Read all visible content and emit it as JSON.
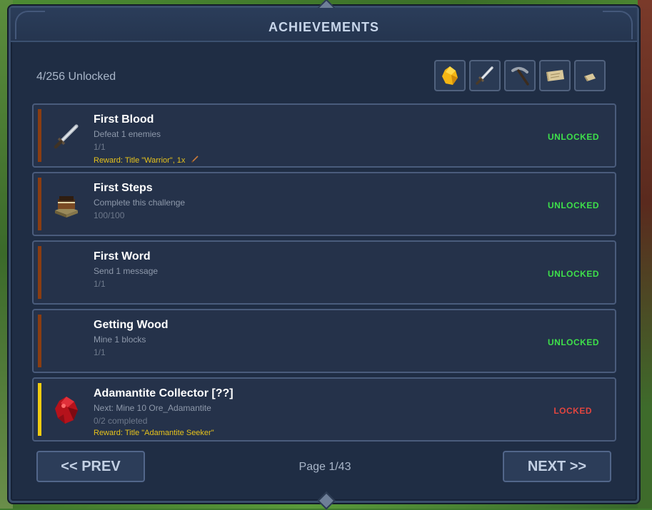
{
  "window": {
    "title": "ACHIEVEMENTS"
  },
  "summary": {
    "unlocked_text": "4/256 Unlocked"
  },
  "filters": [
    {
      "icon": "gold-ore-icon"
    },
    {
      "icon": "sword-icon"
    },
    {
      "icon": "pickaxe-icon"
    },
    {
      "icon": "map-scroll-icon"
    },
    {
      "icon": "letter-icon"
    }
  ],
  "achievements": [
    {
      "name": "First Blood",
      "description": "Defeat 1 enemies",
      "progress": "1/1",
      "reward": "Reward: Title \"Warrior\", 1x",
      "status": "UNLOCKED",
      "icon": "sword-icon"
    },
    {
      "name": "First Steps",
      "description": "Complete this challenge",
      "progress": "100/100",
      "reward": "",
      "status": "UNLOCKED",
      "icon": "book-stack-icon"
    },
    {
      "name": "First Word",
      "description": "Send 1 message",
      "progress": "1/1",
      "reward": "",
      "status": "UNLOCKED",
      "icon": ""
    },
    {
      "name": "Getting Wood",
      "description": "Mine 1 blocks",
      "progress": "1/1",
      "reward": "",
      "status": "UNLOCKED",
      "icon": ""
    },
    {
      "name": "Adamantite Collector [??]",
      "description": "Next: Mine 10 Ore_Adamantite",
      "progress": "0/2 completed",
      "reward": "Reward: Title \"Adamantite Seeker\"",
      "status": "LOCKED",
      "icon": "red-crystal-icon"
    }
  ],
  "pagination": {
    "prev_label": "<< PREV",
    "next_label": "NEXT >>",
    "page_text": "Page 1/43"
  },
  "colors": {
    "unlocked": "#3ee04a",
    "locked": "#e2453f",
    "reward": "#e6c21c",
    "accent_unlocked": "#8a3d12",
    "accent_locked": "#f2cc10"
  }
}
